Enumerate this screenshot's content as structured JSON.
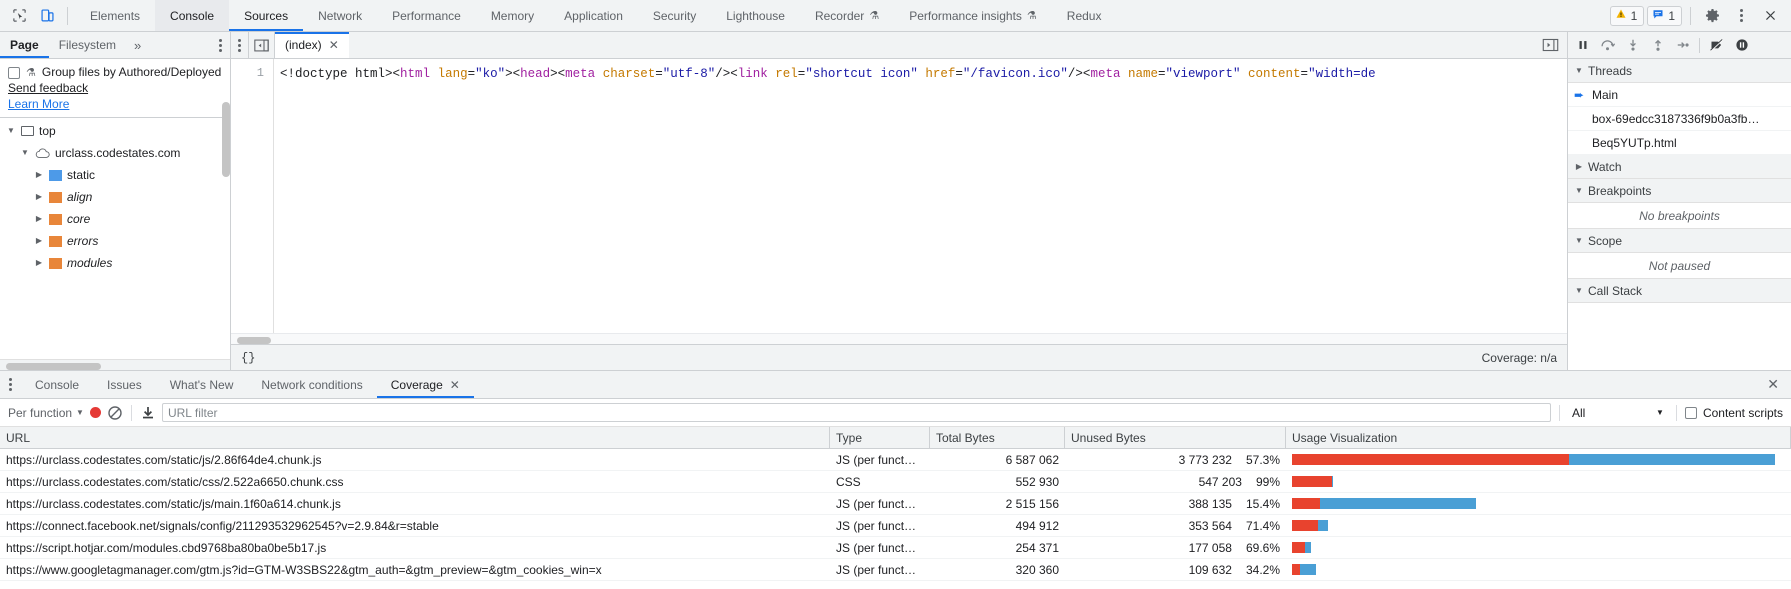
{
  "topbar": {
    "inspect_icon": "cursor-inspect-icon",
    "device_icon": "device-toolbar-icon",
    "tabs": [
      {
        "label": "Elements",
        "state": "normal",
        "flask": false
      },
      {
        "label": "Console",
        "state": "hovered",
        "flask": false
      },
      {
        "label": "Sources",
        "state": "selected",
        "flask": false
      },
      {
        "label": "Network",
        "state": "normal",
        "flask": false
      },
      {
        "label": "Performance",
        "state": "normal",
        "flask": false
      },
      {
        "label": "Memory",
        "state": "normal",
        "flask": false
      },
      {
        "label": "Application",
        "state": "normal",
        "flask": false
      },
      {
        "label": "Security",
        "state": "normal",
        "flask": false
      },
      {
        "label": "Lighthouse",
        "state": "normal",
        "flask": false
      },
      {
        "label": "Recorder",
        "state": "normal",
        "flask": true
      },
      {
        "label": "Performance insights",
        "state": "normal",
        "flask": true
      },
      {
        "label": "Redux",
        "state": "normal",
        "flask": false
      }
    ],
    "warning_count": "1",
    "message_count": "1",
    "settings_icon": "gear-icon",
    "kebab_icon": "more-options-icon",
    "close_icon": "close-icon"
  },
  "navigator": {
    "tabs": [
      {
        "label": "Page",
        "selected": true
      },
      {
        "label": "Filesystem",
        "selected": false
      }
    ],
    "more_label": "»",
    "kebab_icon": "more-options-icon",
    "group_files_label": "Group files by Authored/Deployed",
    "flask_icon": "experiment-flask-icon",
    "send_feedback_label": "Send feedback",
    "learn_more_label": "Learn More",
    "tree": [
      {
        "label": "top",
        "indent": 0,
        "expanded": true,
        "icon": "frame-icon",
        "italic": false
      },
      {
        "label": "urclass.codestates.com",
        "indent": 1,
        "expanded": true,
        "icon": "cloud-icon",
        "italic": false
      },
      {
        "label": "static",
        "indent": 2,
        "expanded": false,
        "icon": "folder-blue-icon",
        "italic": false
      },
      {
        "label": "align",
        "indent": 2,
        "expanded": false,
        "icon": "folder-orange-icon",
        "italic": true
      },
      {
        "label": "core",
        "indent": 2,
        "expanded": false,
        "icon": "folder-orange-icon",
        "italic": true
      },
      {
        "label": "errors",
        "indent": 2,
        "expanded": false,
        "icon": "folder-orange-icon",
        "italic": true
      },
      {
        "label": "modules",
        "indent": 2,
        "expanded": false,
        "icon": "folder-orange-icon",
        "italic": true
      }
    ]
  },
  "editor": {
    "kebab_icon": "more-options-icon",
    "panel_toggle_icon": "show-navigator-icon",
    "tab_label": "(index)",
    "tab_close_icon": "close-icon",
    "right_toggle_icon": "show-debugger-sidebar-icon",
    "line_number": "1",
    "code_tokens": [
      {
        "t": "<!doctype html><",
        "c": "plain"
      },
      {
        "t": "html",
        "c": "tag"
      },
      {
        "t": " ",
        "c": "plain"
      },
      {
        "t": "lang",
        "c": "attr"
      },
      {
        "t": "=",
        "c": "plain"
      },
      {
        "t": "\"ko\"",
        "c": "str"
      },
      {
        "t": "><",
        "c": "plain"
      },
      {
        "t": "head",
        "c": "tag"
      },
      {
        "t": "><",
        "c": "plain"
      },
      {
        "t": "meta",
        "c": "tag"
      },
      {
        "t": " ",
        "c": "plain"
      },
      {
        "t": "charset",
        "c": "attr"
      },
      {
        "t": "=",
        "c": "plain"
      },
      {
        "t": "\"utf-8\"",
        "c": "str"
      },
      {
        "t": "/><",
        "c": "plain"
      },
      {
        "t": "link",
        "c": "tag"
      },
      {
        "t": " ",
        "c": "plain"
      },
      {
        "t": "rel",
        "c": "attr"
      },
      {
        "t": "=",
        "c": "plain"
      },
      {
        "t": "\"shortcut icon\"",
        "c": "str"
      },
      {
        "t": " ",
        "c": "plain"
      },
      {
        "t": "href",
        "c": "attr"
      },
      {
        "t": "=",
        "c": "plain"
      },
      {
        "t": "\"/favicon.ico\"",
        "c": "str"
      },
      {
        "t": "/><",
        "c": "plain"
      },
      {
        "t": "meta",
        "c": "tag"
      },
      {
        "t": " ",
        "c": "plain"
      },
      {
        "t": "name",
        "c": "attr"
      },
      {
        "t": "=",
        "c": "plain"
      },
      {
        "t": "\"viewport\"",
        "c": "str"
      },
      {
        "t": " ",
        "c": "plain"
      },
      {
        "t": "content",
        "c": "attr"
      },
      {
        "t": "=",
        "c": "plain"
      },
      {
        "t": "\"width=de",
        "c": "str"
      }
    ],
    "format_label": "{}",
    "coverage_status": "Coverage: n/a"
  },
  "debugger": {
    "buttons": [
      {
        "icon": "pause-script-icon",
        "name": "pause-resume-button"
      },
      {
        "icon": "step-over-icon",
        "name": "step-over-button"
      },
      {
        "icon": "step-into-icon",
        "name": "step-into-button"
      },
      {
        "icon": "step-out-icon",
        "name": "step-out-button"
      },
      {
        "icon": "step-icon",
        "name": "step-button"
      },
      {
        "icon": "deactivate-breakpoints-icon",
        "name": "deactivate-breakpoints-button"
      },
      {
        "icon": "pause-on-exceptions-icon",
        "name": "pause-on-exceptions-button"
      }
    ],
    "sections": [
      {
        "title": "Threads",
        "expanded": true
      },
      {
        "title": "Watch",
        "expanded": false
      },
      {
        "title": "Breakpoints",
        "expanded": true
      },
      {
        "title": "Scope",
        "expanded": true
      },
      {
        "title": "Call Stack",
        "expanded": true
      }
    ],
    "threads": [
      {
        "label": "Main",
        "current": true
      },
      {
        "label": "box-69edcc3187336f9b0a3fb…",
        "current": false
      },
      {
        "label": "Beq5YUTp.html",
        "current": false
      }
    ],
    "no_breakpoints_label": "No breakpoints",
    "not_paused_label": "Not paused"
  },
  "drawer": {
    "kebab_icon": "more-options-icon",
    "tabs": [
      {
        "label": "Console",
        "selected": false,
        "closable": false
      },
      {
        "label": "Issues",
        "selected": false,
        "closable": false
      },
      {
        "label": "What's New",
        "selected": false,
        "closable": false
      },
      {
        "label": "Network conditions",
        "selected": false,
        "closable": false
      },
      {
        "label": "Coverage",
        "selected": true,
        "closable": true
      }
    ],
    "close_icon": "close-icon",
    "toolbar": {
      "granularity_label": "Per function",
      "record_icon": "record-icon",
      "clear_icon": "clear-icon",
      "export_icon": "download-export-icon",
      "url_filter_placeholder": "URL filter",
      "url_filter_value": "",
      "type_filter_value": "All",
      "content_scripts_label": "Content scripts",
      "content_scripts_checked": false
    },
    "table": {
      "columns": [
        "URL",
        "Type",
        "Total Bytes",
        "Unused Bytes",
        "Usage Visualization"
      ],
      "rows": [
        {
          "url": "https://urclass.codestates.com/static/js/2.86f64de4.chunk.js",
          "type": "JS (per funct…",
          "total_bytes": "6 587 062",
          "unused_bytes": "3 773 232",
          "unused_pct": "57.3%",
          "bar_total_pct": 100,
          "bar_unused_frac": 57.3
        },
        {
          "url": "https://urclass.codestates.com/static/css/2.522a6650.chunk.css",
          "type": "CSS",
          "total_bytes": "552 930",
          "unused_bytes": "547 203",
          "unused_pct": "99%",
          "bar_total_pct": 8.4,
          "bar_unused_frac": 99
        },
        {
          "url": "https://urclass.codestates.com/static/js/main.1f60a614.chunk.js",
          "type": "JS (per funct…",
          "total_bytes": "2 515 156",
          "unused_bytes": "388 135",
          "unused_pct": "15.4%",
          "bar_total_pct": 38.2,
          "bar_unused_frac": 15.4
        },
        {
          "url": "https://connect.facebook.net/signals/config/211293532962545?v=2.9.84&r=stable",
          "type": "JS (per funct…",
          "total_bytes": "494 912",
          "unused_bytes": "353 564",
          "unused_pct": "71.4%",
          "bar_total_pct": 7.5,
          "bar_unused_frac": 71.4
        },
        {
          "url": "https://script.hotjar.com/modules.cbd9768ba80ba0be5b17.js",
          "type": "JS (per funct…",
          "total_bytes": "254 371",
          "unused_bytes": "177 058",
          "unused_pct": "69.6%",
          "bar_total_pct": 3.9,
          "bar_unused_frac": 69.6
        },
        {
          "url": "https://www.googletagmanager.com/gtm.js?id=GTM-W3SBS22&gtm_auth=&gtm_preview=&gtm_cookies_win=x",
          "type": "JS (per funct…",
          "total_bytes": "320 360",
          "unused_bytes": "109 632",
          "unused_pct": "34.2%",
          "bar_total_pct": 4.9,
          "bar_unused_frac": 34.2
        }
      ]
    }
  },
  "colors": {
    "accent": "#1a73e8",
    "folder_orange": "#e8863a",
    "folder_blue": "#4d9ae8",
    "bar_used": "#4a9fd5",
    "bar_unused": "#e8432e",
    "record_red": "#e53935",
    "warning_yellow": "#f2b200"
  }
}
